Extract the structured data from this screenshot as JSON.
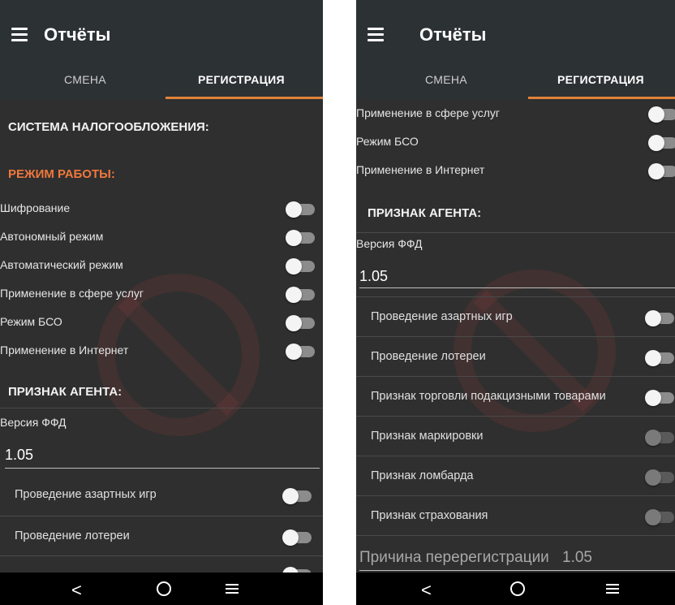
{
  "left": {
    "title": "Отчёты",
    "tabs": [
      "СМЕНА",
      "РЕГИСТРАЦИЯ"
    ],
    "sections": {
      "taxation": "СИСТЕМА НАЛОГООБЛОЖЕНИЯ:",
      "work_mode": "РЕЖИМ РАБОТЫ:",
      "agent": "ПРИЗНАК АГЕНТА:"
    },
    "toggles": [
      {
        "label": "Шифрование",
        "on": false
      },
      {
        "label": "Автономный режим",
        "on": false
      },
      {
        "label": "Автоматический режим",
        "on": false
      },
      {
        "label": "Применение в сфере услуг",
        "on": false
      },
      {
        "label": "Режим БСО",
        "on": false
      },
      {
        "label": "Применение в Интернет",
        "on": false
      }
    ],
    "ffd_label": "Версия ФФД",
    "ffd_value": "1.05",
    "cards": [
      {
        "label": "Проведение азартных игр",
        "on": false
      },
      {
        "label": "Проведение лотереи",
        "on": false
      }
    ]
  },
  "right": {
    "title": "Отчёты",
    "tabs": [
      "СМЕНА",
      "РЕГИСТРАЦИЯ"
    ],
    "toggles": [
      {
        "label": "Применение в сфере услуг",
        "on": false
      },
      {
        "label": "Режим БСО",
        "on": false
      },
      {
        "label": "Применение в Интернет",
        "on": false
      }
    ],
    "agent": "ПРИЗНАК АГЕНТА:",
    "ffd_label": "Версия ФФД",
    "ffd_value": "1.05",
    "cards": [
      {
        "label": "Проведение азартных игр",
        "on": false,
        "disabled": false
      },
      {
        "label": "Проведение лотереи",
        "on": false,
        "disabled": false
      },
      {
        "label": "Признак торговли подакцизными товарами",
        "on": false,
        "disabled": false
      },
      {
        "label": "Признак маркировки",
        "on": false,
        "disabled": true
      },
      {
        "label": "Признак ломбарда",
        "on": false,
        "disabled": true
      },
      {
        "label": "Признак страхования",
        "on": false,
        "disabled": true
      }
    ],
    "rereg_label": "Причина перерегистрации",
    "rereg_value": "1.05"
  },
  "colors": {
    "appbar": "#2c3134",
    "background": "#2f2f2f",
    "accent": "#f0783c",
    "navbar": "#000000"
  }
}
